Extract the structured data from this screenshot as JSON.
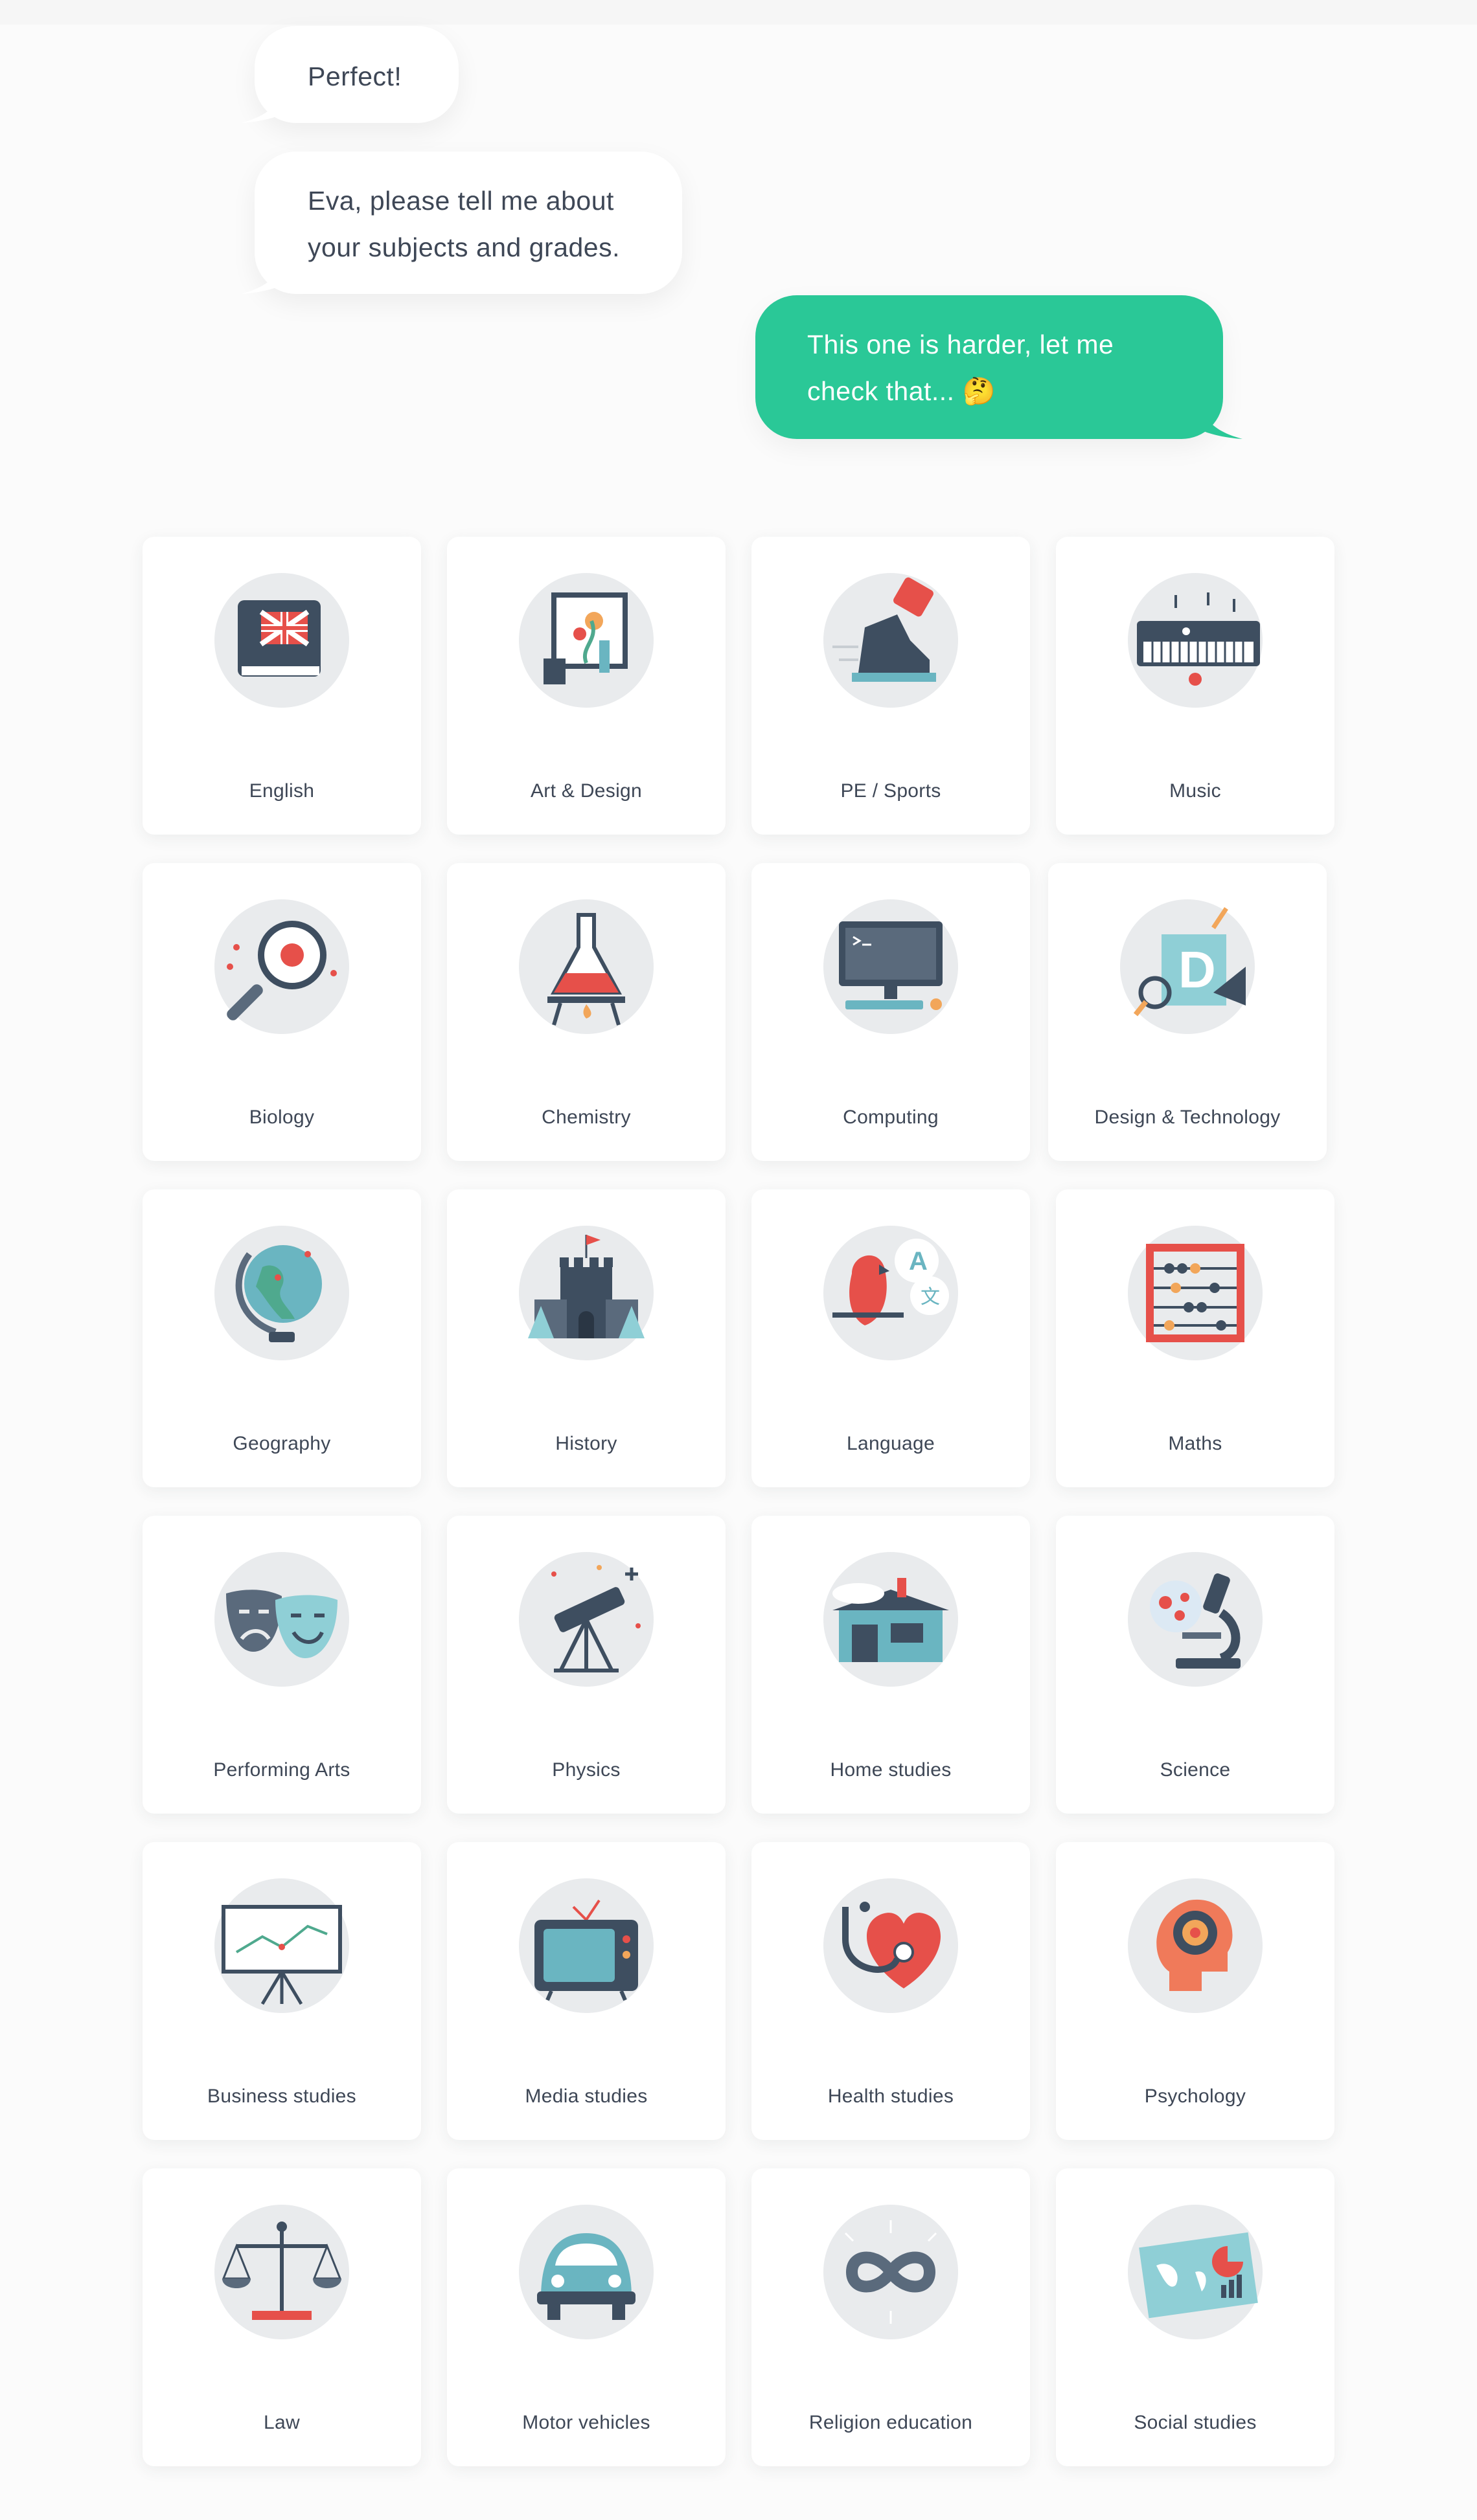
{
  "chat": {
    "messages": [
      {
        "from": "bot",
        "text": "Perfect!"
      },
      {
        "from": "bot",
        "text": "Eva, please tell me about\nyour subjects and grades."
      },
      {
        "from": "user",
        "text": "This one is harder, let me\ncheck that... 🤔"
      }
    ]
  },
  "colors": {
    "accent": "#2ac897",
    "text": "#3e4756",
    "card_bg": "#ffffff",
    "page_bg": "#fbfbfb"
  },
  "subjects": [
    {
      "label": "English",
      "icon": "book-icon"
    },
    {
      "label": "Art & Design",
      "icon": "easel-icon"
    },
    {
      "label": "PE / Sports",
      "icon": "sneaker-icon"
    },
    {
      "label": "Music",
      "icon": "keyboard-icon"
    },
    {
      "label": "Biology",
      "icon": "magnifier-ladybug-icon"
    },
    {
      "label": "Chemistry",
      "icon": "flask-icon"
    },
    {
      "label": "Computing",
      "icon": "computer-icon"
    },
    {
      "label": "Design & Technology",
      "icon": "design-tools-icon"
    },
    {
      "label": "Geography",
      "icon": "globe-icon"
    },
    {
      "label": "History",
      "icon": "castle-icon"
    },
    {
      "label": "Language",
      "icon": "parrot-icon"
    },
    {
      "label": "Maths",
      "icon": "abacus-icon"
    },
    {
      "label": "Performing Arts",
      "icon": "theatre-masks-icon"
    },
    {
      "label": "Physics",
      "icon": "telescope-icon"
    },
    {
      "label": "Home studies",
      "icon": "house-icon"
    },
    {
      "label": "Science",
      "icon": "microscope-icon"
    },
    {
      "label": "Business studies",
      "icon": "presentation-board-icon"
    },
    {
      "label": "Media studies",
      "icon": "television-icon"
    },
    {
      "label": "Health studies",
      "icon": "stethoscope-heart-icon"
    },
    {
      "label": "Psychology",
      "icon": "head-brain-icon"
    },
    {
      "label": "Law",
      "icon": "scales-icon"
    },
    {
      "label": "Motor vehicles",
      "icon": "car-icon"
    },
    {
      "label": "Religion education",
      "icon": "infinity-icon"
    },
    {
      "label": "Social studies",
      "icon": "map-chart-icon"
    }
  ]
}
